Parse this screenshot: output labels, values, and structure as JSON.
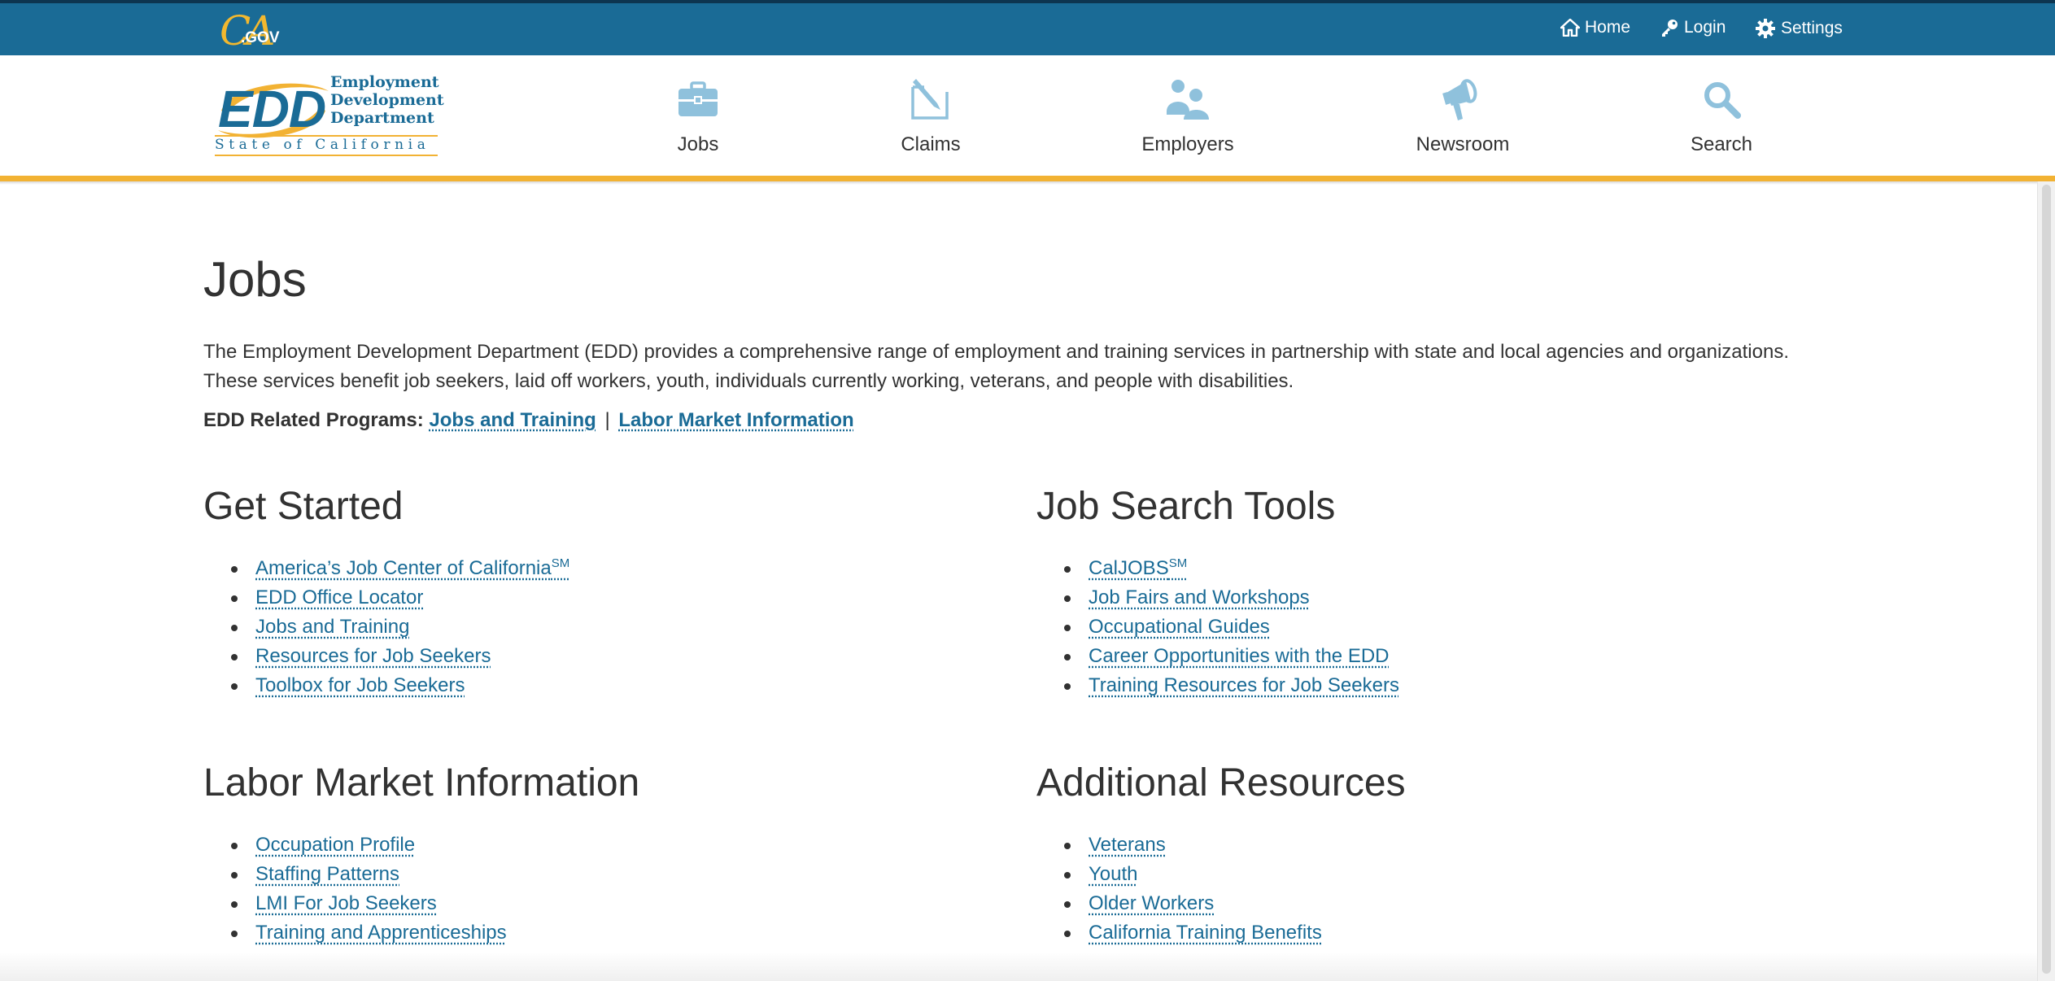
{
  "topbar": {
    "ca_logo": {
      "ca": "CA",
      "gov": ".GOV"
    },
    "links": [
      {
        "label": "Home",
        "icon": "home-icon"
      },
      {
        "label": "Login",
        "icon": "key-icon"
      },
      {
        "label": "Settings",
        "icon": "gear-icon"
      }
    ]
  },
  "header": {
    "logo": {
      "letters": "EDD",
      "dept_line1": "Employment",
      "dept_line2": "Development",
      "dept_line3": "Department",
      "subtitle": "State of California"
    },
    "nav": [
      {
        "label": "Jobs",
        "icon": "briefcase-icon"
      },
      {
        "label": "Claims",
        "icon": "form-pen-icon"
      },
      {
        "label": "Employers",
        "icon": "people-icon"
      },
      {
        "label": "Newsroom",
        "icon": "megaphone-icon"
      },
      {
        "label": "Search",
        "icon": "search-icon"
      }
    ]
  },
  "main": {
    "title": "Jobs",
    "intro_line1": "The Employment Development Department (EDD) provides a comprehensive range of employment and training services in partnership with state and local agencies and organizations.",
    "intro_line2": "These services benefit job seekers, laid off workers, youth, individuals currently working, veterans, and people with disabilities.",
    "related": {
      "label": "EDD Related Programs:",
      "links": [
        "Jobs and Training",
        "Labor Market Information"
      ],
      "separator": "|"
    },
    "sections": {
      "get_started": {
        "heading": "Get Started",
        "items": [
          {
            "label": "America’s Job Center of California",
            "sup": "SM"
          },
          {
            "label": "EDD Office Locator"
          },
          {
            "label": "Jobs and Training"
          },
          {
            "label": "Resources for Job Seekers"
          },
          {
            "label": "Toolbox for Job Seekers"
          }
        ]
      },
      "job_search_tools": {
        "heading": "Job Search Tools",
        "items": [
          {
            "label": "CalJOBS",
            "sup": "SM"
          },
          {
            "label": "Job Fairs and Workshops"
          },
          {
            "label": "Occupational Guides"
          },
          {
            "label": "Career Opportunities with the EDD"
          },
          {
            "label": "Training Resources for Job Seekers"
          }
        ]
      },
      "labor_market_information": {
        "heading": "Labor Market Information",
        "items": [
          {
            "label": "Occupation Profile"
          },
          {
            "label": "Staffing Patterns"
          },
          {
            "label": "LMI For Job Seekers"
          },
          {
            "label": "Training and Apprenticeships"
          }
        ]
      },
      "additional_resources": {
        "heading": "Additional Resources",
        "items": [
          {
            "label": "Veterans"
          },
          {
            "label": "Youth"
          },
          {
            "label": "Older Workers"
          },
          {
            "label": "California Training Benefits"
          }
        ]
      }
    }
  },
  "colors": {
    "brand_blue": "#1a6b96",
    "topbar": "#1a6b96",
    "accent_gold": "#f2b233",
    "nav_icon": "#8fc1dc",
    "text": "#323232"
  }
}
